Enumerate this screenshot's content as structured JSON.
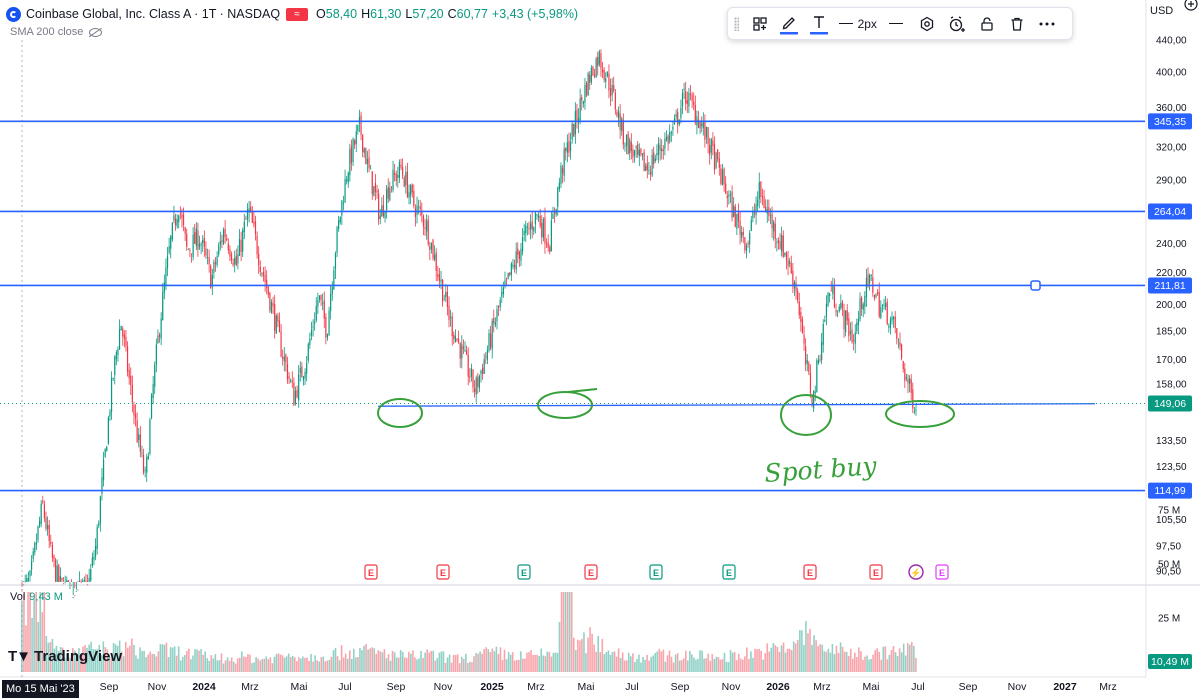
{
  "header": {
    "title": "Coinbase Global, Inc. Class A · 1T · NASDAQ",
    "flag": "≈",
    "o_label": "O",
    "o_value": "58,40",
    "h_label": "H",
    "h_value": "61,30",
    "l_label": "L",
    "l_value": "57,20",
    "c_label": "C",
    "c_value": "60,77",
    "change": "+3,43 (+5,98%)"
  },
  "indicator": {
    "label": "SMA 200 close"
  },
  "toolbar": {
    "width_label": "2px"
  },
  "watermark": {
    "text": "TradingView"
  },
  "volume": {
    "label": "Vol",
    "value": "9,43 M"
  },
  "currency": "USD",
  "start_date": "Mo 15 Mai '23",
  "colors": {
    "up": "#089981",
    "down": "#f23645",
    "line": "#2962ff",
    "ink": "#37a03b"
  },
  "chart_data": {
    "type": "candlestick",
    "price_axis": {
      "scale": "log",
      "ticks": [
        {
          "value": 90.5,
          "label": "90,50"
        },
        {
          "value": 97.5,
          "label": "97,50"
        },
        {
          "value": 105.5,
          "label": "105,50"
        },
        {
          "value": 114.99,
          "label": "114,99"
        },
        {
          "value": 123.5,
          "label": "123,50"
        },
        {
          "value": 133.5,
          "label": "133,50"
        },
        {
          "value": 149.06,
          "label": "149,06"
        },
        {
          "value": 158,
          "label": "158,00"
        },
        {
          "value": 170,
          "label": "170,00"
        },
        {
          "value": 185,
          "label": "185,00"
        },
        {
          "value": 200,
          "label": "200,00"
        },
        {
          "value": 211.81,
          "label": "211,81"
        },
        {
          "value": 220,
          "label": "220,00"
        },
        {
          "value": 240,
          "label": "240,00"
        },
        {
          "value": 264.04,
          "label": "264,04"
        },
        {
          "value": 290,
          "label": "290,00"
        },
        {
          "value": 320,
          "label": "320,00"
        },
        {
          "value": 345.35,
          "label": "345,35"
        },
        {
          "value": 360,
          "label": "360,00"
        },
        {
          "value": 400,
          "label": "400,00"
        },
        {
          "value": 440,
          "label": "440,00"
        }
      ]
    },
    "volume_axis": {
      "ticks": [
        {
          "value": 25,
          "label": "25 M"
        },
        {
          "value": 50,
          "label": "50 M"
        },
        {
          "value": 75,
          "label": "75 M"
        }
      ],
      "current": "10,49 M"
    },
    "time_axis": [
      "Sep",
      "Nov",
      "2024",
      "Mrz",
      "Mai",
      "Jul",
      "Sep",
      "Nov",
      "2025",
      "Mrz",
      "Mai",
      "Jul",
      "Sep",
      "Nov",
      "2026",
      "Mrz",
      "Mai",
      "Jul",
      "Sep",
      "Nov",
      "2027",
      "Mrz"
    ],
    "horizontal_lines": [
      {
        "value": 345.35,
        "label": "345,35"
      },
      {
        "value": 264.04,
        "label": "264,04"
      },
      {
        "value": 211.81,
        "label": "211,81"
      },
      {
        "value": 114.99,
        "label": "114,99"
      }
    ],
    "last_price": {
      "value": 149.06,
      "label": "149,06"
    },
    "trend_line_value": 148.5,
    "annotation_text": "Spot buy",
    "earnings_markers": [
      "E",
      "E",
      "E",
      "E",
      "E",
      "E",
      "E",
      "E",
      "E"
    ],
    "dividend_marker": "⚡",
    "price_path": [
      [
        0,
        85
      ],
      [
        0.02,
        88
      ],
      [
        0.05,
        110
      ],
      [
        0.07,
        95
      ],
      [
        0.09,
        87
      ],
      [
        0.12,
        85
      ],
      [
        0.16,
        86
      ],
      [
        0.18,
        98
      ],
      [
        0.2,
        125
      ],
      [
        0.22,
        160
      ],
      [
        0.24,
        190
      ],
      [
        0.26,
        160
      ],
      [
        0.28,
        135
      ],
      [
        0.3,
        118
      ],
      [
        0.32,
        160
      ],
      [
        0.34,
        200
      ],
      [
        0.36,
        240
      ],
      [
        0.38,
        270
      ],
      [
        0.4,
        235
      ],
      [
        0.43,
        245
      ],
      [
        0.46,
        215
      ],
      [
        0.49,
        250
      ],
      [
        0.52,
        225
      ],
      [
        0.55,
        265
      ],
      [
        0.58,
        225
      ],
      [
        0.6,
        205
      ],
      [
        0.63,
        175
      ],
      [
        0.66,
        152
      ],
      [
        0.69,
        170
      ],
      [
        0.72,
        205
      ],
      [
        0.74,
        185
      ],
      [
        0.76,
        235
      ],
      [
        0.79,
        300
      ],
      [
        0.82,
        340
      ],
      [
        0.84,
        300
      ],
      [
        0.87,
        260
      ],
      [
        0.89,
        285
      ],
      [
        0.92,
        300
      ],
      [
        0.95,
        270
      ],
      [
        0.98,
        255
      ],
      [
        1.01,
        220
      ],
      [
        1.04,
        190
      ],
      [
        1.07,
        172
      ],
      [
        1.1,
        155
      ],
      [
        1.13,
        175
      ],
      [
        1.16,
        200
      ],
      [
        1.19,
        222
      ],
      [
        1.22,
        245
      ],
      [
        1.25,
        262
      ],
      [
        1.28,
        240
      ],
      [
        1.31,
        300
      ],
      [
        1.34,
        340
      ],
      [
        1.37,
        385
      ],
      [
        1.4,
        420
      ],
      [
        1.43,
        380
      ],
      [
        1.46,
        330
      ],
      [
        1.49,
        310
      ],
      [
        1.52,
        300
      ],
      [
        1.55,
        320
      ],
      [
        1.58,
        335
      ],
      [
        1.61,
        375
      ],
      [
        1.64,
        350
      ],
      [
        1.67,
        320
      ],
      [
        1.7,
        290
      ],
      [
        1.73,
        260
      ],
      [
        1.76,
        240
      ],
      [
        1.79,
        280
      ],
      [
        1.82,
        255
      ],
      [
        1.85,
        235
      ],
      [
        1.88,
        210
      ],
      [
        1.9,
        170
      ],
      [
        1.92,
        150
      ],
      [
        1.94,
        180
      ],
      [
        1.96,
        210
      ],
      [
        1.98,
        200
      ],
      [
        2.0,
        190
      ],
      [
        2.02,
        180
      ],
      [
        2.04,
        205
      ],
      [
        2.06,
        215
      ],
      [
        2.08,
        200
      ],
      [
        2.1,
        195
      ],
      [
        2.12,
        185
      ],
      [
        2.14,
        165
      ],
      [
        2.16,
        152
      ],
      [
        2.17,
        149
      ]
    ],
    "volume_levels": [
      [
        0,
        30
      ],
      [
        0.03,
        42
      ],
      [
        0.06,
        24
      ],
      [
        0.1,
        8
      ],
      [
        0.14,
        9
      ],
      [
        0.18,
        11
      ],
      [
        0.22,
        10
      ],
      [
        0.26,
        12
      ],
      [
        0.3,
        8
      ],
      [
        0.34,
        10
      ],
      [
        0.38,
        9
      ],
      [
        0.42,
        8
      ],
      [
        0.46,
        7
      ],
      [
        0.5,
        6
      ],
      [
        0.54,
        7
      ],
      [
        0.58,
        6
      ],
      [
        0.62,
        7
      ],
      [
        0.66,
        8
      ],
      [
        0.7,
        7
      ],
      [
        0.74,
        8
      ],
      [
        0.78,
        9
      ],
      [
        0.82,
        10
      ],
      [
        0.86,
        9
      ],
      [
        0.9,
        8
      ],
      [
        0.94,
        7
      ],
      [
        0.98,
        8
      ],
      [
        1.02,
        7
      ],
      [
        1.06,
        6
      ],
      [
        1.1,
        7
      ],
      [
        1.14,
        9
      ],
      [
        1.18,
        8
      ],
      [
        1.22,
        7
      ],
      [
        1.26,
        8
      ],
      [
        1.3,
        9
      ],
      [
        1.32,
        85
      ],
      [
        1.34,
        12
      ],
      [
        1.38,
        15
      ],
      [
        1.42,
        11
      ],
      [
        1.46,
        8
      ],
      [
        1.5,
        7
      ],
      [
        1.54,
        8
      ],
      [
        1.58,
        7
      ],
      [
        1.62,
        8
      ],
      [
        1.66,
        7
      ],
      [
        1.7,
        7
      ],
      [
        1.74,
        8
      ],
      [
        1.78,
        9
      ],
      [
        1.82,
        10
      ],
      [
        1.86,
        11
      ],
      [
        1.9,
        18
      ],
      [
        1.94,
        12
      ],
      [
        1.98,
        10
      ],
      [
        2.02,
        9
      ],
      [
        2.06,
        8
      ],
      [
        2.1,
        9
      ],
      [
        2.14,
        10
      ],
      [
        2.17,
        10.49
      ]
    ]
  }
}
